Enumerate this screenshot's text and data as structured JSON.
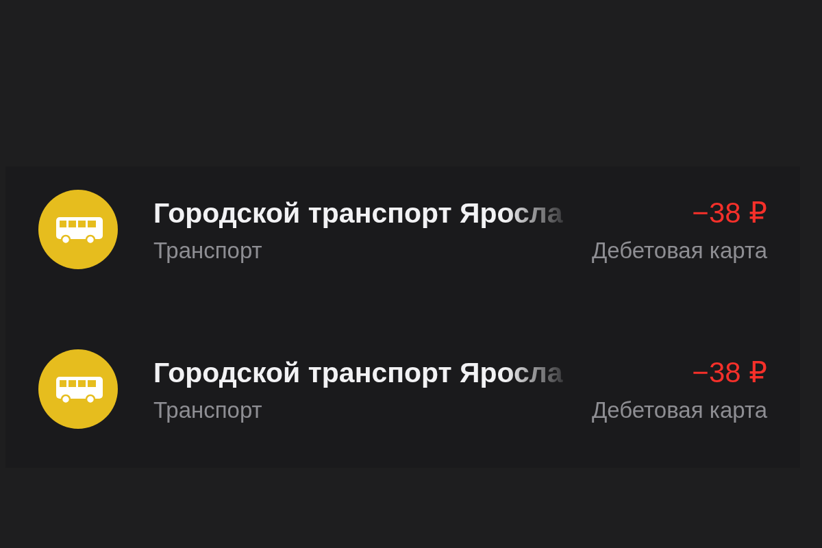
{
  "transactions": [
    {
      "title": "Городской транспорт Яросла",
      "category": "Транспорт",
      "amount": "−38 ₽",
      "source": "Дебетовая карта",
      "kind": "expense"
    },
    {
      "title": "Городской транспорт Яросла",
      "category": "Транспорт",
      "amount": "−38 ₽",
      "source": "Дебетовая карта",
      "kind": "expense"
    }
  ]
}
